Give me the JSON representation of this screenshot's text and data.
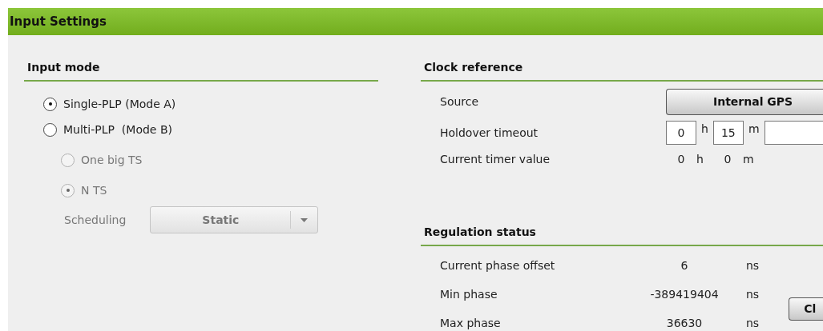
{
  "title": "Input Settings",
  "input_mode": {
    "heading": "Input mode",
    "options": [
      {
        "label": "Single-PLP (Mode A)",
        "selected": true,
        "disabled": false
      },
      {
        "label": "Multi-PLP  (Mode B)",
        "selected": false,
        "disabled": false
      }
    ],
    "sub_options": [
      {
        "label": "One big TS",
        "selected": false,
        "disabled": true
      },
      {
        "label": "N TS",
        "selected": true,
        "disabled": true
      }
    ],
    "scheduling": {
      "label": "Scheduling",
      "value": "Static",
      "disabled": true
    }
  },
  "clock_reference": {
    "heading": "Clock reference",
    "rows": [
      {
        "kind": "button",
        "label": "Source",
        "value": "Internal GPS"
      },
      {
        "kind": "inputs",
        "label": "Holdover timeout",
        "fields": [
          {
            "value": "0",
            "unit": "h"
          },
          {
            "value": "15",
            "unit": "m"
          }
        ]
      },
      {
        "kind": "values",
        "label": "Current timer value",
        "fields": [
          {
            "value": "0",
            "unit": "h"
          },
          {
            "value": "0",
            "unit": "m"
          }
        ]
      }
    ]
  },
  "regulation_status": {
    "heading": "Regulation status",
    "rows": [
      {
        "label": "Current phase offset",
        "value": "6",
        "unit": "ns"
      },
      {
        "label": "Min phase",
        "value": "-389419404",
        "unit": "ns"
      },
      {
        "label": "Max phase",
        "value": "36630",
        "unit": "ns"
      }
    ],
    "button": "Cl"
  }
}
